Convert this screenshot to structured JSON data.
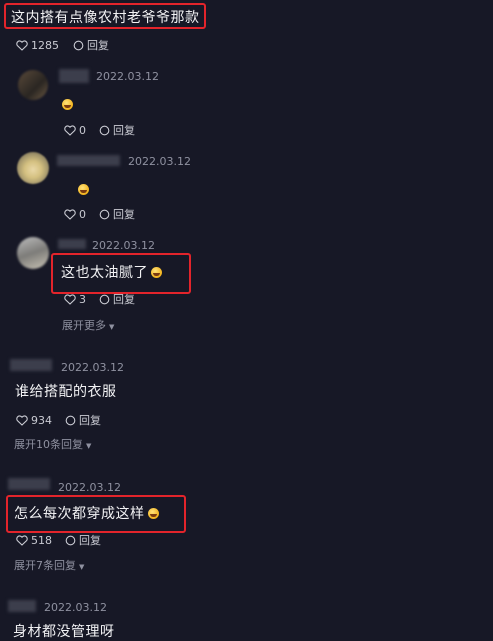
{
  "top_comment": {
    "text": "这内搭有点像农村老爷爷那款",
    "likes": "1285",
    "reply_label": "回复"
  },
  "replies": [
    {
      "date": "2022.03.12",
      "likes": "0",
      "reply_label": "回复"
    },
    {
      "date": "2022.03.12",
      "likes": "0",
      "reply_label": "回复"
    },
    {
      "date": "2022.03.12",
      "text": "这也太油腻了",
      "likes": "3",
      "reply_label": "回复"
    }
  ],
  "expand_more": "展开更多",
  "comments": [
    {
      "date": "2022.03.12",
      "text": "谁给搭配的衣服",
      "likes": "934",
      "reply_label": "回复",
      "expand": "展开10条回复"
    },
    {
      "date": "2022.03.12",
      "text": "怎么每次都穿成这样",
      "likes": "518",
      "reply_label": "回复",
      "expand": "展开7条回复"
    },
    {
      "date": "2022.03.12",
      "text": "身材都没管理呀"
    }
  ],
  "colors": {
    "background": "#171826",
    "highlight": "#e3242b",
    "muted": "#8f91a0"
  },
  "icons": [
    "heart-icon",
    "comment-icon",
    "laugh-emoji-icon",
    "chevron-down-icon"
  ]
}
